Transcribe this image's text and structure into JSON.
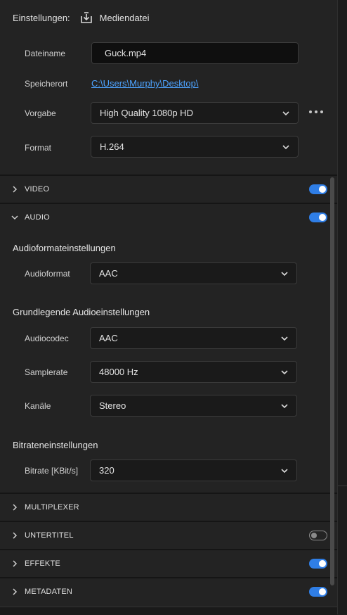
{
  "header": {
    "title": "Einstellungen:",
    "export_label": "Mediendatei"
  },
  "file": {
    "name_label": "Dateiname",
    "name_value": "Guck.mp4",
    "location_label": "Speicherort",
    "location_value": "C:\\Users\\Murphy\\Desktop\\",
    "preset_label": "Vorgabe",
    "preset_value": "High Quality 1080p HD",
    "format_label": "Format",
    "format_value": "H.264"
  },
  "sections": {
    "video": {
      "label": "VIDEO",
      "enabled": true
    },
    "audio": {
      "label": "AUDIO",
      "enabled": true
    },
    "multiplexer": {
      "label": "MULTIPLEXER"
    },
    "captions": {
      "label": "UNTERTITEL",
      "enabled": false
    },
    "effects": {
      "label": "EFFEKTE",
      "enabled": true
    },
    "metadata": {
      "label": "METADATEN",
      "enabled": true
    }
  },
  "audio": {
    "format_heading": "Audioformateinstellungen",
    "format_label": "Audioformat",
    "format_value": "AAC",
    "basic_heading": "Grundlegende Audioeinstellungen",
    "codec_label": "Audiocodec",
    "codec_value": "AAC",
    "samplerate_label": "Samplerate",
    "samplerate_value": "48000 Hz",
    "channels_label": "Kanäle",
    "channels_value": "Stereo",
    "bitrate_heading": "Bitrateneinstellungen",
    "bitrate_label": "Bitrate [KBit/s]",
    "bitrate_value": "320"
  },
  "colors": {
    "accent": "#2f7ee6",
    "link": "#4da3ff",
    "panel": "#232323"
  }
}
